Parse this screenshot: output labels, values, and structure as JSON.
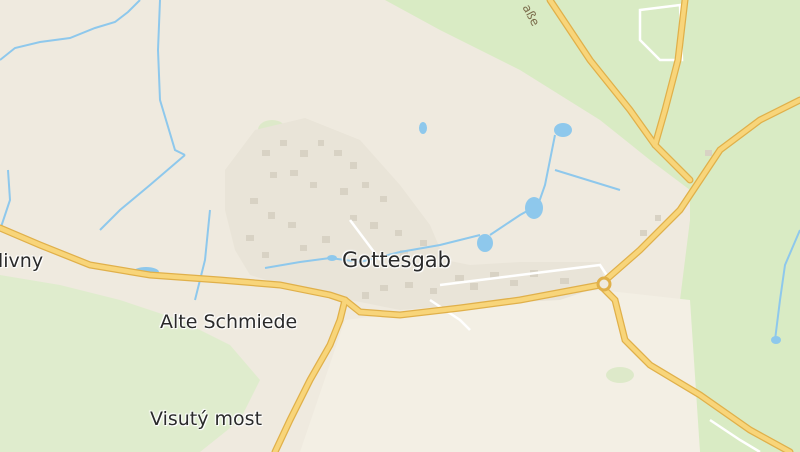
{
  "labels": {
    "town": "Gottesgab",
    "alte_schmiede": "Alte Schmiede",
    "visuty_most": "Visutý most",
    "edge_left": "livny",
    "street_fragment": "aße"
  },
  "colors": {
    "land": "#efeadf",
    "forest": "#d9ebc4",
    "water": "#8ec8ec",
    "road_fill": "#f8d57a",
    "road_casing": "#e0b04a",
    "building": "#d8d2c4"
  }
}
